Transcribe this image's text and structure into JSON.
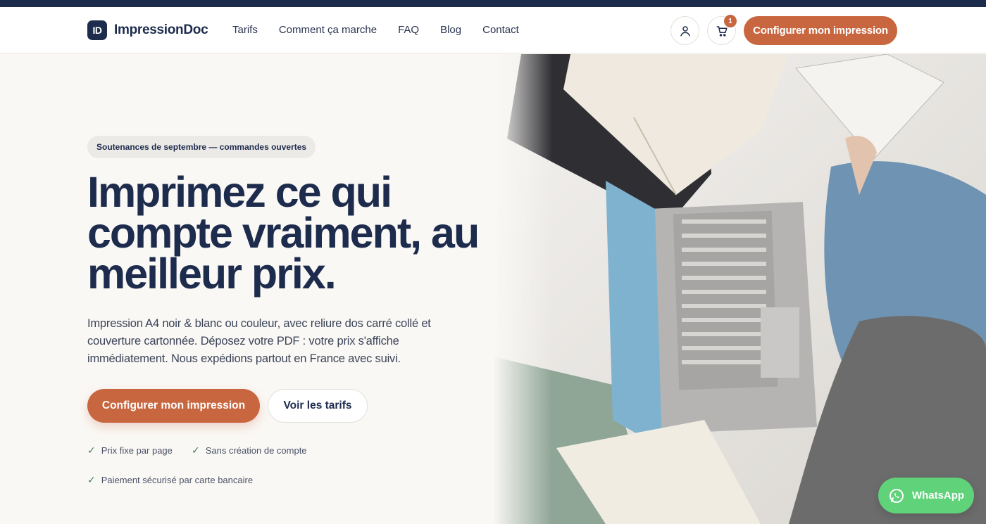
{
  "header": {
    "logo_mark": "ID",
    "brand": "ImpressionDoc",
    "nav": [
      {
        "label": "Tarifs"
      },
      {
        "label": "Comment ça marche"
      },
      {
        "label": "FAQ"
      },
      {
        "label": "Blog"
      },
      {
        "label": "Contact"
      }
    ],
    "cart_count": "1",
    "cta_label": "Configurer mon impression",
    "icons": [
      "user-icon",
      "cart-icon"
    ]
  },
  "hero": {
    "pill": "Soutenances de septembre — commandes ouvertes",
    "headline_lines": [
      "Imprimez ce qui",
      "compte vraiment, au",
      "meilleur prix."
    ],
    "subtitle_lines": [
      "Impression A4 noir & blanc ou couleur, avec reliure dos carré collé et",
      "couverture cartonnée. Déposez votre PDF : votre prix s'affiche",
      "immédiatement. Nous expédions partout en France avec suivi."
    ],
    "primary_cta": "Configurer mon impression",
    "secondary_cta": "Voir les tarifs",
    "checks": [
      {
        "label": "Prix fixe par page"
      },
      {
        "label": "Sans création de compte"
      },
      {
        "label": "Paiement sécurisé par carte bancaire"
      }
    ],
    "image_alt_icon": "photo-laptop-books"
  },
  "whatsapp": {
    "label": "WhatsApp"
  },
  "colors": {
    "navy": "#1d2b4d",
    "accent": "#c8663f",
    "background": "#faf8f5",
    "whatsapp": "#5fd27a"
  }
}
